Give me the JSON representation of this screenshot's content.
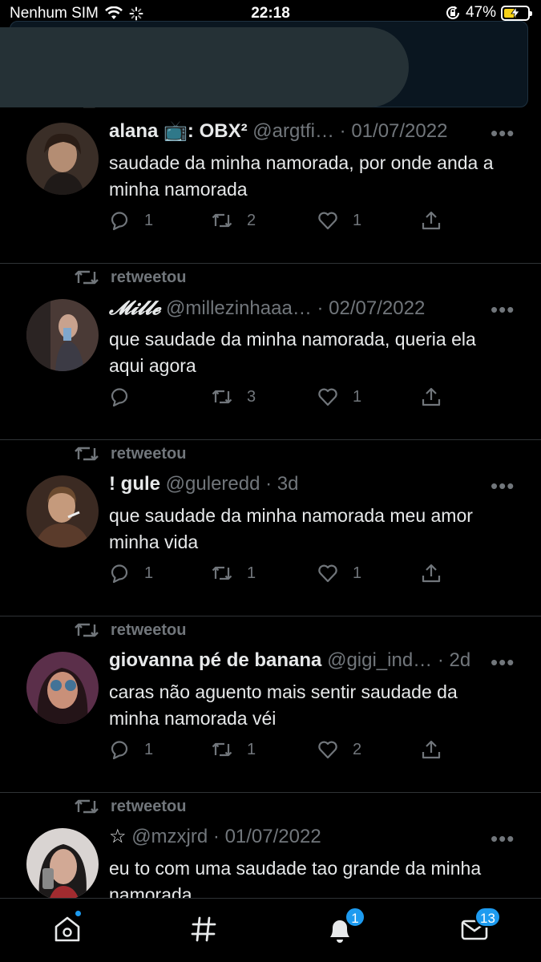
{
  "status_bar": {
    "carrier": "Nenhum SIM",
    "time": "22:18",
    "battery": "47%"
  },
  "retweet_label": "retweetou",
  "tweets": [
    {
      "name": "alana 📺: OBX²",
      "handle": "@argtfi…",
      "date": "01/07/2022",
      "text": "saudade da minha namorada, por onde anda a minha namorada",
      "replies": "1",
      "retweets": "2",
      "likes": "1"
    },
    {
      "name": "𝓜𝓲𝓵𝓵𝓮",
      "handle": "@millezinhaaa…",
      "date": "02/07/2022",
      "text": "que saudade da minha namorada, queria ela aqui agora",
      "replies": "",
      "retweets": "3",
      "likes": "1"
    },
    {
      "name": "! gule",
      "handle": "@guleredd",
      "date": "3d",
      "text": "que saudade da minha namorada meu amor minha vida",
      "replies": "1",
      "retweets": "1",
      "likes": "1"
    },
    {
      "name": "giovanna pé de banana",
      "handle": "@gigi_ind…",
      "date": "2d",
      "text": "caras não aguento mais sentir saudade da minha namorada véi",
      "replies": "1",
      "retweets": "1",
      "likes": "2"
    },
    {
      "name": "☆",
      "handle": "@mzxjrd",
      "date": "01/07/2022",
      "text": "eu to com uma saudade tao grande da minha namorada",
      "replies": "",
      "retweets": "",
      "likes": ""
    }
  ],
  "nav": {
    "notifications_badge": "1",
    "messages_badge": "13"
  },
  "colors": {
    "background": "#000000",
    "text": "#e7e9ea",
    "muted": "#71767b",
    "accent": "#1d9bf0",
    "battery_fill": "#f7d117"
  }
}
